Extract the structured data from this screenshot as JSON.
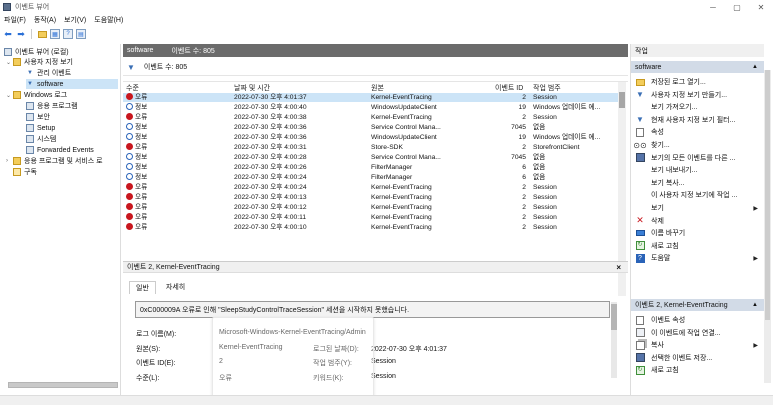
{
  "window": {
    "title": "이벤트 뷰어",
    "minimize": "─",
    "maximize": "▢",
    "close": "✕"
  },
  "menu": [
    "파일(F)",
    "동작(A)",
    "보기(V)",
    "도움말(H)"
  ],
  "tree": {
    "items": [
      {
        "label": "이벤트 뷰어 (로컬)",
        "icon": "event-viewer-icon"
      },
      {
        "label": "사용자 지정 보기",
        "icon": "folder-icon",
        "expander": "⌄"
      },
      {
        "label": "관리 이벤트",
        "icon": "filter-icon"
      },
      {
        "label": "software",
        "icon": "filter-icon",
        "selected": true
      },
      {
        "label": "Windows 로그",
        "icon": "folder-icon",
        "expander": "⌄"
      },
      {
        "label": "응용 프로그램",
        "icon": "log-icon"
      },
      {
        "label": "보안",
        "icon": "log-icon"
      },
      {
        "label": "Setup",
        "icon": "log-icon"
      },
      {
        "label": "시스템",
        "icon": "log-icon"
      },
      {
        "label": "Forwarded Events",
        "icon": "log-icon"
      },
      {
        "label": "응용 프로그램 및 서비스 로",
        "icon": "folder-icon",
        "expander": "›"
      },
      {
        "label": "구독",
        "icon": "subscription-icon"
      }
    ]
  },
  "center": {
    "pane_title": "software",
    "pane_count": "이벤트 수: 805",
    "filter_text": "이벤트 수: 805",
    "columns": {
      "level": "수준",
      "date": "날짜 및 시간",
      "source": "원본",
      "event_id": "이벤트 ID",
      "category": "작업 범주"
    },
    "rows": [
      {
        "level": "오류",
        "type": "error",
        "date": "2022-07-30 오후 4:01:37",
        "source": "Kernel-EventTracing",
        "id": "2",
        "category": "Session"
      },
      {
        "level": "정보",
        "type": "info",
        "date": "2022-07-30 오후 4:00:40",
        "source": "WindowsUpdateClient",
        "id": "19",
        "category": "Windows 업데이트 에..."
      },
      {
        "level": "오류",
        "type": "error",
        "date": "2022-07-30 오후 4:00:38",
        "source": "Kernel-EventTracing",
        "id": "2",
        "category": "Session"
      },
      {
        "level": "정보",
        "type": "info",
        "date": "2022-07-30 오후 4:00:36",
        "source": "Service Control Mana...",
        "id": "7045",
        "category": "없음"
      },
      {
        "level": "정보",
        "type": "info",
        "date": "2022-07-30 오후 4:00:36",
        "source": "WindowsUpdateClient",
        "id": "19",
        "category": "Windows 업데이트 에..."
      },
      {
        "level": "오류",
        "type": "error",
        "date": "2022-07-30 오후 4:00:31",
        "source": "Store-SDK",
        "id": "2",
        "category": "StorefrontClient"
      },
      {
        "level": "정보",
        "type": "info",
        "date": "2022-07-30 오후 4:00:28",
        "source": "Service Control Mana...",
        "id": "7045",
        "category": "없음"
      },
      {
        "level": "정보",
        "type": "info",
        "date": "2022-07-30 오후 4:00:26",
        "source": "FilterManager",
        "id": "6",
        "category": "없음"
      },
      {
        "level": "정보",
        "type": "info",
        "date": "2022-07-30 오후 4:00:24",
        "source": "FilterManager",
        "id": "6",
        "category": "없음"
      },
      {
        "level": "오류",
        "type": "error",
        "date": "2022-07-30 오후 4:00:24",
        "source": "Kernel-EventTracing",
        "id": "2",
        "category": "Session"
      },
      {
        "level": "오류",
        "type": "error",
        "date": "2022-07-30 오후 4:00:13",
        "source": "Kernel-EventTracing",
        "id": "2",
        "category": "Session"
      },
      {
        "level": "오류",
        "type": "error",
        "date": "2022-07-30 오후 4:00:12",
        "source": "Kernel-EventTracing",
        "id": "2",
        "category": "Session"
      },
      {
        "level": "오류",
        "type": "error",
        "date": "2022-07-30 오후 4:00:11",
        "source": "Kernel-EventTracing",
        "id": "2",
        "category": "Session"
      },
      {
        "level": "오류",
        "type": "error",
        "date": "2022-07-30 오후 4:00:10",
        "source": "Kernel-EventTracing",
        "id": "2",
        "category": "Session"
      }
    ],
    "detail": {
      "header": "이벤트 2, Kernel-EventTracing",
      "close": "×",
      "tabs": [
        "일반",
        "자세히"
      ],
      "message": "0xC000009A 오류로 인해 \"SleepStudyControlTraceSession\" 세션을 시작하지 못했습니다.",
      "log_name_label": "로그 이름(M):",
      "log_name_value": "Microsoft-Windows-Kernel-EventTracing/Admin",
      "source_label": "원본(S):",
      "source_value": "Kernel-EventTracing",
      "logged_label": "로그된 날짜(D):",
      "logged_value": "2022-07-30 오후 4:01:37",
      "event_id_label": "이벤트 ID(E):",
      "event_id_value": "2",
      "category_label": "작업 범주(Y):",
      "category_value": "Session",
      "level_label": "수준(L):",
      "level_value": "오류",
      "keywords_label": "키워드(K):",
      "keywords_value": "Session"
    }
  },
  "actions": {
    "title": "작업",
    "section1": "software",
    "section1_items": [
      {
        "label": "저장된 로그 열기...",
        "icon": "open-folder-icon"
      },
      {
        "label": "사용자 지정 보기 만들기...",
        "icon": "filter-icon"
      },
      {
        "label": "보기 가져오기...",
        "icon": ""
      },
      {
        "label": "현재 사용자 지정 보기 필터...",
        "icon": "filter-icon"
      },
      {
        "label": "속성",
        "icon": "properties-icon"
      },
      {
        "label": "찾기...",
        "icon": "binoculars-icon"
      },
      {
        "label": "보기의 모든 이벤트를 다른 ...",
        "icon": "save-icon"
      },
      {
        "label": "보기 내보내기...",
        "icon": ""
      },
      {
        "label": "보기 복사...",
        "icon": ""
      },
      {
        "label": "이 사용자 지정 보기에 작업 ...",
        "icon": ""
      },
      {
        "label": "보기",
        "icon": "",
        "submenu": "▶"
      },
      {
        "label": "삭제",
        "icon": "delete-icon"
      },
      {
        "label": "이름 바꾸기",
        "icon": "rename-icon"
      },
      {
        "label": "새로 고침",
        "icon": "refresh-icon"
      },
      {
        "label": "도움말",
        "icon": "help-icon",
        "submenu": "▶"
      }
    ],
    "section2": "이벤트 2, Kernel-EventTracing",
    "section2_items": [
      {
        "label": "이벤트 속성",
        "icon": "event-properties-icon"
      },
      {
        "label": "이 이벤트에 작업 연결...",
        "icon": "attach-task-icon"
      },
      {
        "label": "복사",
        "icon": "copy-icon",
        "submenu": "▶"
      },
      {
        "label": "선택한 이벤트 저장...",
        "icon": "save-icon"
      },
      {
        "label": "새로 고침",
        "icon": "refresh-icon"
      }
    ]
  },
  "colors": {
    "accent": "#2a63b8",
    "error": "#c8161d",
    "header_dark": "#6b6b6b",
    "selection": "#cce4f7",
    "section_head": "#d2dbe7"
  }
}
